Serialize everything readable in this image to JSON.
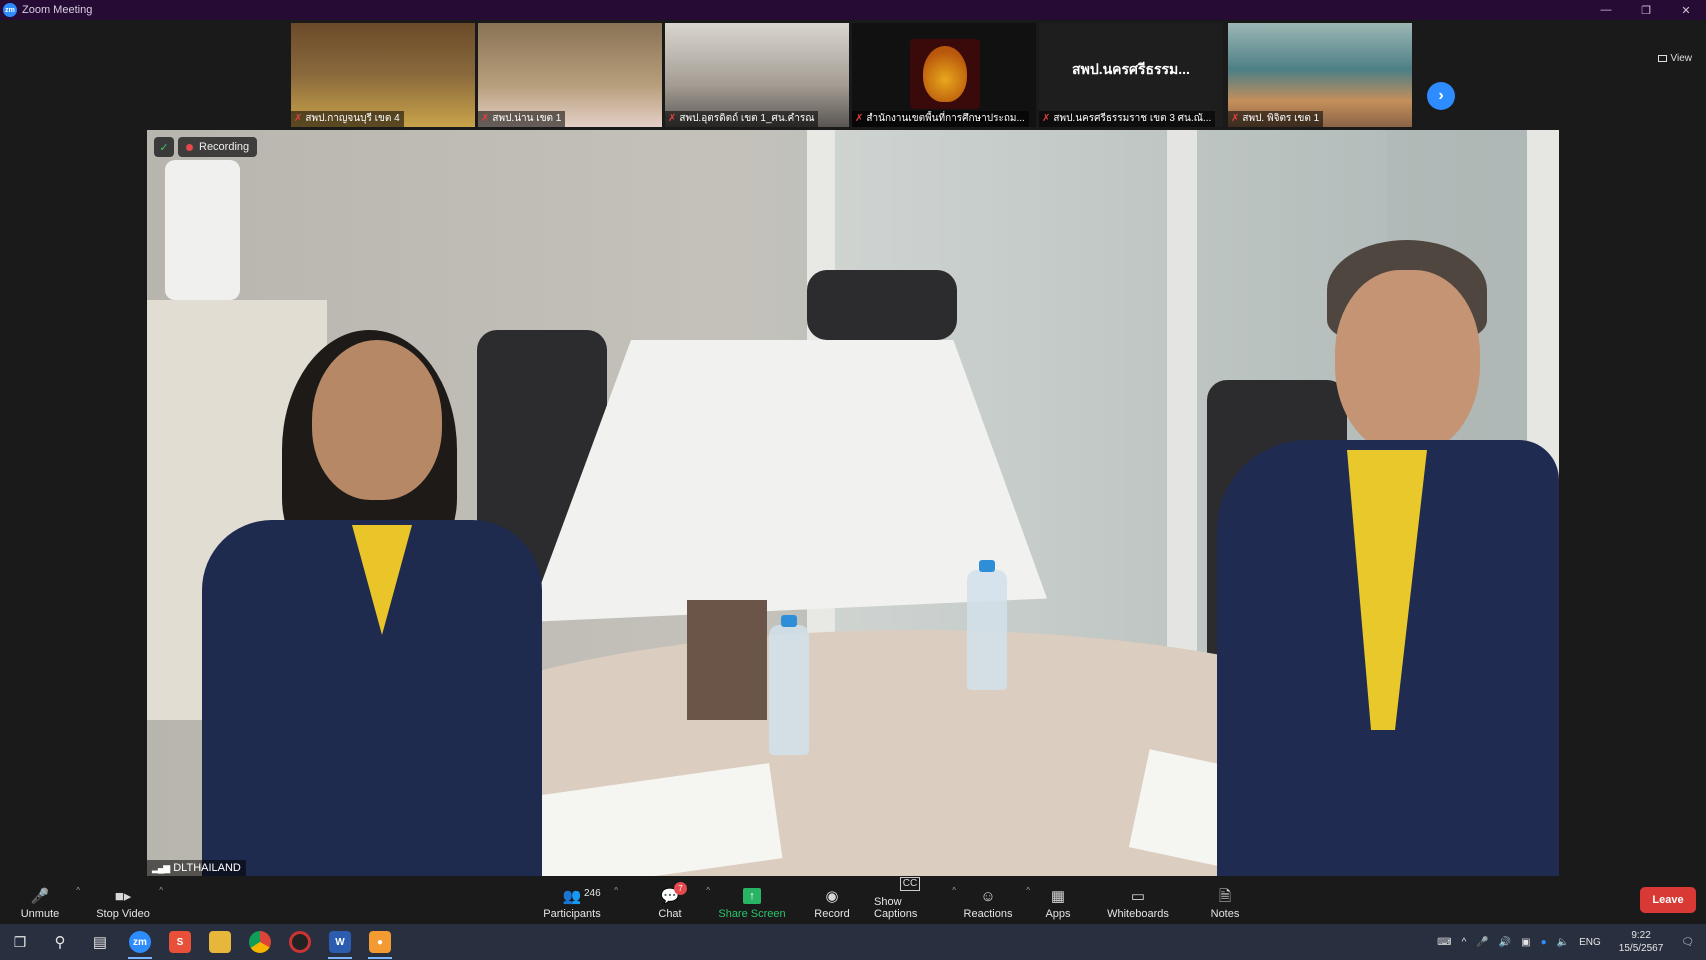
{
  "window": {
    "title": "Zoom Meeting",
    "logo": "zm"
  },
  "gallery": {
    "tiles": [
      {
        "name": "สพป.กาญจนบุรี เขต 4"
      },
      {
        "name": "สพป.น่าน เขต 1"
      },
      {
        "name": "สพป.อุตรดิตถ์ เขต 1_ศน.คำรณ"
      },
      {
        "name": "สำนักงานเขตพื้นที่การศึกษาประถม..."
      },
      {
        "name": "สพป.นครศรีธรรมราช เขต 3 ศน.ณั...",
        "display_text": "สพป.นครศรีธรรม..."
      },
      {
        "name": "สพป. พิจิตร เขต 1"
      }
    ],
    "next_icon": "chevron-right-icon",
    "view_label": "View"
  },
  "main": {
    "recording_label": "Recording",
    "participant_name": "DLTHAILAND"
  },
  "toolbar": {
    "unmute": "Unmute",
    "stop_video": "Stop Video",
    "participants": "Participants",
    "participants_count": "246",
    "chat": "Chat",
    "chat_badge": "7",
    "share_screen": "Share Screen",
    "record": "Record",
    "show_captions": "Show Captions",
    "captions_icon_text": "CC",
    "reactions": "Reactions",
    "apps": "Apps",
    "whiteboards": "Whiteboards",
    "notes": "Notes",
    "leave": "Leave"
  },
  "taskbar": {
    "zoom_label": "zm",
    "word_label": "W",
    "lang": "ENG",
    "time": "9:22",
    "date": "15/5/2567"
  },
  "colors": {
    "titlebar": "#260b35",
    "accent": "#2d8cff",
    "share_green": "#28b463",
    "leave_red": "#d93934",
    "recording_dot": "#e5484d"
  }
}
